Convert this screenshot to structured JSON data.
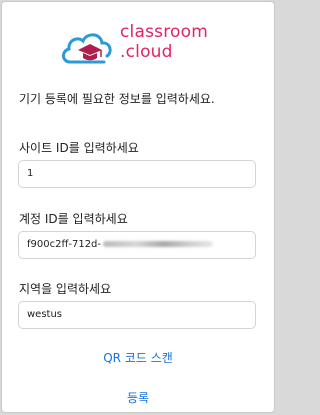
{
  "brand": {
    "line1": "classroom",
    "line2": ".cloud",
    "color_text": "#e2245f",
    "color_cloud": "#2b9ad6",
    "color_cap": "#b01e4c"
  },
  "intro_text": "기기 등록에 필요한 정보를 입력하세요.",
  "fields": [
    {
      "label": "사이트 ID를 입력하세요",
      "value": "1"
    },
    {
      "label": "계정 ID를 입력하세요",
      "value": "f900c2ff-712d-"
    },
    {
      "label": "지역을 입력하세요",
      "value": "westus"
    }
  ],
  "links": {
    "qr_scan": "QR 코드 스캔",
    "register": "등록"
  },
  "accent_color": "#1a73d9"
}
